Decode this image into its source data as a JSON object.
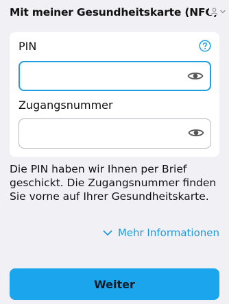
{
  "header": {
    "title": "Mit meiner Gesundheitskarte (NFC)"
  },
  "form": {
    "pin_label": "PIN",
    "pin_value": "",
    "access_label": "Zugangsnummer",
    "access_value": ""
  },
  "info_text": "Die PIN haben wir Ihnen per Brief geschickt. Die Zugangsnummer finden Sie vorne auf Ihrer Gesundheitskarte.",
  "more_link": "Mehr Informationen",
  "primary_button": "Weiter",
  "colors": {
    "accent": "#1d9fe0",
    "button": "#1aa5ec",
    "link": "#1f98d8",
    "background": "#f1f0f5"
  },
  "icons": {
    "help": "question-circle-icon",
    "pin_visibility": "eye-icon",
    "access_visibility": "eye-icon",
    "expand": "chevron-down-icon"
  }
}
